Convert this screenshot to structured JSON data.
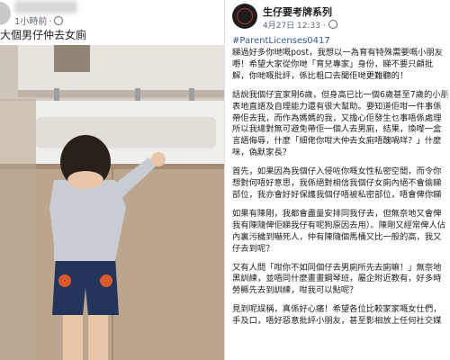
{
  "left_post": {
    "timestamp": "1小時前",
    "caption": "大個男仔仲去女廁"
  },
  "right_post": {
    "page_name": "生仔要考牌系列",
    "date": "4月27日 12:33",
    "hashtag": "#ParentLicenses0417",
    "paragraphs": [
      [
        "睇過好多你哋嘅post，我想以一為育有特殊需要嘅小朋友",
        "嘢！希望大家從你哋「育兒專家」身份，睇不要只顧批",
        "解，你哋嘅批評，係比粗口去聞佢哋更難聽的！"
      ],
      [
        "話說我個仔宜家剛6歲，但身高已比一個6歲甚至7歲的小朋",
        "表地直語及自理能力還有很大幫助。要知道佢咁一件事係",
        "帶佢去我，而作為媽媽的我，又擔心佢發生乜事唔係處理",
        "所以我總對無可避免帶佢一個人去男廁，結果，換嚟一盒",
        "言語侮辱，什麼「細佬你咁大仲去女廁唔醜喎咩？」什麼",
        "咪，偽默家長？"
      ],
      [
        "首先，如果因為我個仔入侵咗你嘅女性私密空間，而令你",
        "想對何唔好意思，我係絕對相信我個仔女廁內絕不會偷睇",
        "部位，我亦會好好保護我個仔唔被私密部位，唔會俾你睇"
      ],
      [
        "如果有陳剛，我都會盡量安排同我仔去，但無奈地又會俾",
        "我有陳隨俾佢睇我仔有呢狗原因去用）。陳剛又經常俾人佔",
        "內裏污穢到嚇死人，仲有陳隨個馬桶又比一般的高，我又",
        "仔去到呢？"
      ],
      [
        "又有人問「咁你不如同個仔去男廁所先去廁嘛！」無奈地",
        "黑訓練，並唔同什麼畫畫鋼琴班，屬企附近教有，好多時",
        "勞縣先去到訓練，咁我可以點呢？"
      ],
      [
        "見到呢誤稱，真係好心痛！希望各位比較家家嘅女仕們，",
        "手及口，唔好惡意批評小朋友，甚至影相放上任何社交媒"
      ]
    ]
  }
}
